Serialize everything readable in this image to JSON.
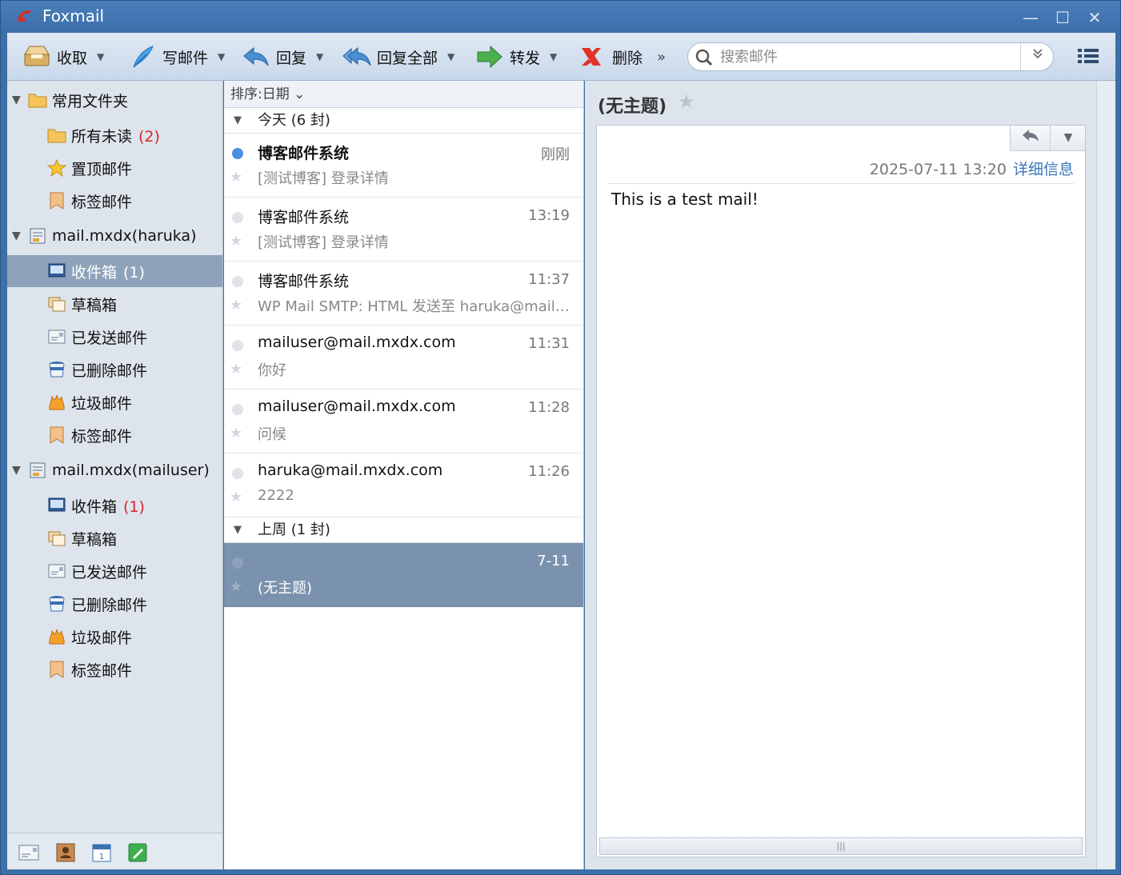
{
  "window": {
    "title": "Foxmail",
    "minimize": "—",
    "maximize": "☐",
    "close": "✕"
  },
  "toolbar": {
    "receive": "收取",
    "compose": "写邮件",
    "reply": "回复",
    "reply_all": "回复全部",
    "forward": "转发",
    "delete": "删除",
    "more": "»",
    "search_placeholder": "搜索邮件",
    "caret": "▼"
  },
  "sidebar": {
    "favorites": {
      "label": "常用文件夹",
      "items": [
        {
          "label": "所有未读",
          "count": "(2)"
        },
        {
          "label": "置顶邮件",
          "count": ""
        },
        {
          "label": "标签邮件",
          "count": ""
        }
      ]
    },
    "accounts": [
      {
        "label": "mail.mxdx(haruka)",
        "items": [
          {
            "label": "收件箱",
            "count": "(1)"
          },
          {
            "label": "草稿箱",
            "count": ""
          },
          {
            "label": "已发送邮件",
            "count": ""
          },
          {
            "label": "已删除邮件",
            "count": ""
          },
          {
            "label": "垃圾邮件",
            "count": ""
          },
          {
            "label": "标签邮件",
            "count": ""
          }
        ]
      },
      {
        "label": "mail.mxdx(mailuser)",
        "items": [
          {
            "label": "收件箱",
            "count": "(1)"
          },
          {
            "label": "草稿箱",
            "count": ""
          },
          {
            "label": "已发送邮件",
            "count": ""
          },
          {
            "label": "已删除邮件",
            "count": ""
          },
          {
            "label": "垃圾邮件",
            "count": ""
          },
          {
            "label": "标签邮件",
            "count": ""
          }
        ]
      }
    ]
  },
  "message_list": {
    "sort_label": "排序:日期 ⌄",
    "groups": [
      {
        "title": "今天 (6 封)"
      },
      {
        "title": "上周 (1 封)"
      }
    ],
    "messages": [
      {
        "from": "博客邮件系统",
        "time": "刚刚",
        "subject": "[测试博客] 登录详情",
        "unread": true
      },
      {
        "from": "博客邮件系统",
        "time": "13:19",
        "subject": "[测试博客] 登录详情",
        "unread": false
      },
      {
        "from": "博客邮件系统",
        "time": "11:37",
        "subject": "WP Mail SMTP: HTML 发送至 haruka@mail....",
        "unread": false
      },
      {
        "from": "mailuser@mail.mxdx.com",
        "time": "11:31",
        "subject": "你好",
        "unread": false
      },
      {
        "from": "mailuser@mail.mxdx.com",
        "time": "11:28",
        "subject": "问候",
        "unread": false
      },
      {
        "from": "haruka@mail.mxdx.com",
        "time": "11:26",
        "subject": "2222",
        "unread": false
      },
      {
        "from": "",
        "time": "7-11",
        "subject": "(无主题)",
        "unread": false
      }
    ]
  },
  "reader": {
    "subject": "(无主题)",
    "datetime": "2025-07-11 13:20",
    "details_link": "详细信息",
    "body": "This is a test mail!",
    "scroll_grip": "|||"
  }
}
